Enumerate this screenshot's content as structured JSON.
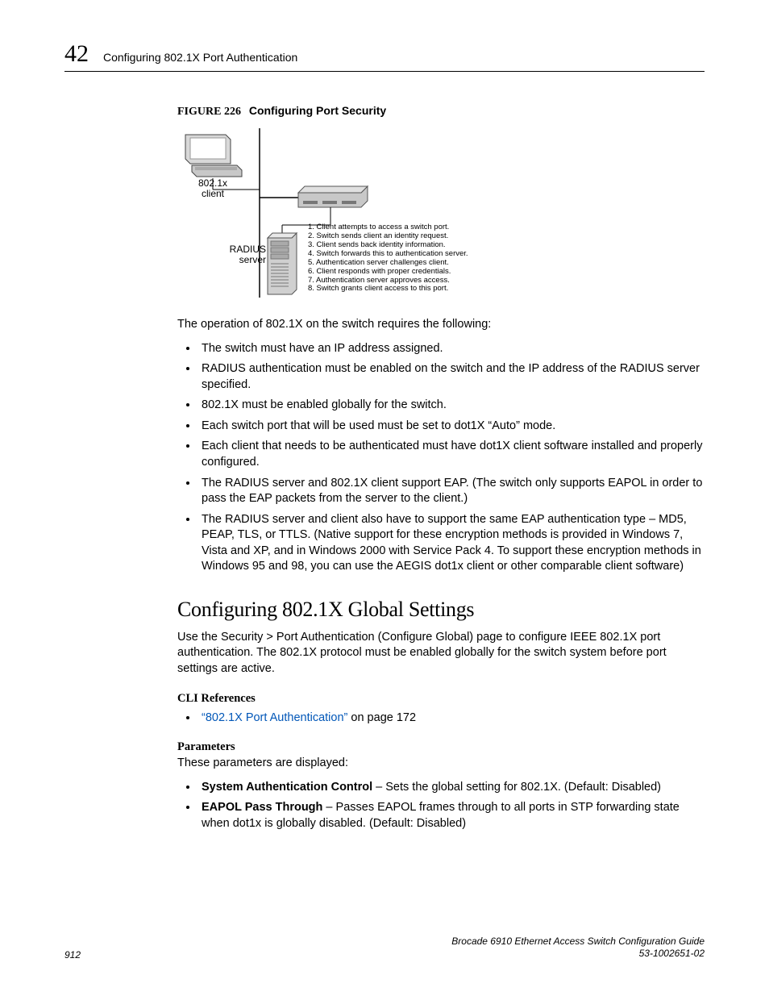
{
  "header": {
    "chapter_number": "42",
    "chapter_title": "Configuring 802.1X Port Authentication"
  },
  "figure": {
    "label": "FIGURE 226",
    "title": "Configuring Port Security",
    "labels": {
      "client": "802.1x\nclient",
      "radius": "RADIUS\nserver"
    },
    "steps": [
      "1. Client attempts to access a switch port.",
      "2. Switch sends client an identity request.",
      "3. Client sends back identity information.",
      "4. Switch forwards this to authentication server.",
      "5. Authentication server challenges client.",
      "6. Client responds with proper credentials.",
      "7. Authentication server approves access.",
      "8. Switch grants client access to this port."
    ]
  },
  "intro_para": "The operation of 802.1X on the switch requires the following:",
  "bullets_main": [
    "The switch must have an IP address assigned.",
    "RADIUS authentication must be enabled on the switch and the IP address of the RADIUS server specified.",
    "802.1X must be enabled globally for the switch.",
    "Each switch port that will be used must be set to dot1X “Auto” mode.",
    "Each client that needs to be authenticated must have dot1X client software installed and properly configured.",
    "The RADIUS server and 802.1X client support EAP. (The switch only supports EAPOL in order to pass the EAP packets from the server to the client.)",
    "The RADIUS server and client also have to support the same EAP authentication type – MD5, PEAP, TLS, or TTLS. (Native support for these encryption methods is provided in Windows 7, Vista and XP, and in Windows 2000 with Service Pack 4. To support these encryption methods in Windows 95 and 98, you can use the AEGIS dot1x client or other comparable client software)"
  ],
  "section1": {
    "heading": "Configuring 802.1X Global Settings",
    "intro": "Use the Security > Port Authentication (Configure Global) page to configure IEEE 802.1X port authentication. The 802.1X protocol must be enabled globally for the switch system before port settings are active.",
    "cli_heading": "CLI References",
    "cli_link_text": "“802.1X Port Authentication”",
    "cli_link_suffix": " on page 172",
    "params_heading": "Parameters",
    "params_intro": "These parameters are displayed:",
    "params": [
      {
        "bold": "System Authentication Control",
        "rest": " – Sets the global setting for 802.1X. (Default: Disabled)"
      },
      {
        "bold": "EAPOL Pass Through",
        "rest": " – Passes EAPOL frames through to all ports in STP forwarding state when dot1x is globally disabled. (Default: Disabled)"
      }
    ]
  },
  "footer": {
    "page_number": "912",
    "book_title": "Brocade 6910 Ethernet Access Switch Configuration Guide",
    "doc_id": "53-1002651-02"
  }
}
